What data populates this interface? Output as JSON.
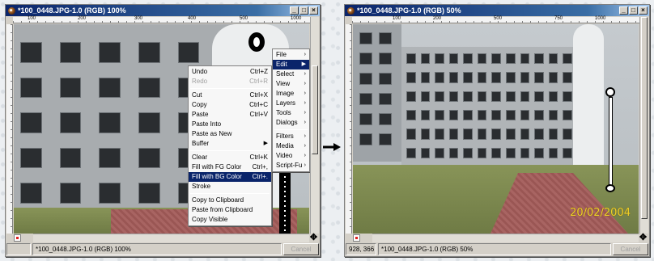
{
  "left_window": {
    "title": "*100_0448.JPG-1.0 (RGB) 100%",
    "ruler_ticks": [
      "100",
      "200",
      "300",
      "400",
      "500",
      "1000"
    ],
    "status_text": "*100_0448.JPG-1.0 (RGB) 100%",
    "cancel_label": "Cancel",
    "context_menu": {
      "items": [
        {
          "label": "File",
          "shortcut": "",
          "submenu": true
        },
        {
          "label": "Edit",
          "shortcut": "",
          "submenu": true,
          "highlight": true
        },
        {
          "label": "Select",
          "shortcut": "",
          "submenu": true
        },
        {
          "label": "View",
          "shortcut": "",
          "submenu": true
        },
        {
          "label": "Image",
          "shortcut": "",
          "submenu": true
        },
        {
          "label": "Layers",
          "shortcut": "",
          "submenu": true
        },
        {
          "label": "Tools",
          "shortcut": "",
          "submenu": true
        },
        {
          "label": "Dialogs",
          "shortcut": "",
          "submenu": true
        },
        {
          "label": "Filters",
          "shortcut": "",
          "submenu": true
        },
        {
          "label": "Media",
          "shortcut": "",
          "submenu": true
        },
        {
          "label": "Video",
          "shortcut": "",
          "submenu": true
        },
        {
          "label": "Script-Fu",
          "shortcut": "",
          "submenu": true
        }
      ]
    },
    "edit_menu": {
      "undo": "Undo",
      "undo_key": "Ctrl+Z",
      "redo": "Redo",
      "redo_key": "Ctrl+R",
      "cut": "Cut",
      "cut_key": "Ctrl+X",
      "copy": "Copy",
      "copy_key": "Ctrl+C",
      "paste": "Paste",
      "paste_key": "Ctrl+V",
      "paste_into": "Paste Into",
      "paste_as_new": "Paste as New",
      "buffer": "Buffer",
      "clear": "Clear",
      "clear_key": "Ctrl+K",
      "fill_fg": "Fill with FG Color",
      "fill_fg_key": "Ctrl+,",
      "fill_bg": "Fill with BG Color",
      "fill_bg_key": "Ctrl+.",
      "stroke": "Stroke",
      "copy_to_clipboard": "Copy to Clipboard",
      "paste_from_clipboard": "Paste from Clipboard",
      "copy_visible": "Copy Visible"
    }
  },
  "right_window": {
    "title": "*100_0448.JPG-1.0 (RGB) 50%",
    "ruler_ticks": [
      "100",
      "200",
      "500",
      "750",
      "1000"
    ],
    "coords": "928, 366",
    "status_text": "*100_0448.JPG-1.0 (RGB) 50%",
    "cancel_label": "Cancel",
    "date_stamp": "20/02/2004"
  },
  "colors": {
    "titlebar": "#0a246a",
    "menu_highlight": "#0a246a",
    "date_stamp": "#f0d02a"
  }
}
